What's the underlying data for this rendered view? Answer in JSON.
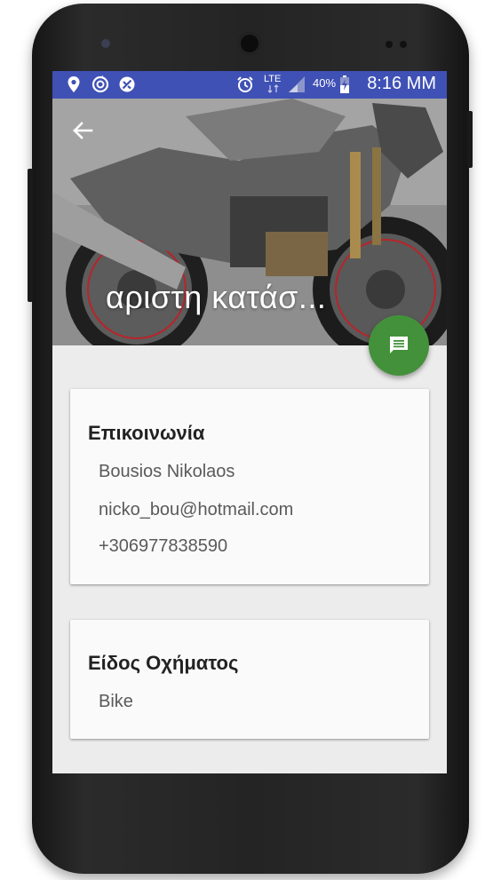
{
  "status_bar": {
    "network": "LTE",
    "battery": "40%",
    "time": "8:16 MM",
    "color": "#3f51b5"
  },
  "header": {
    "title": "αριστη κατάσ..."
  },
  "contact_card": {
    "title": "Επικοινωνία",
    "name": "Bousios Nikolaos",
    "email": "nicko_bou@hotmail.com",
    "phone": "+306977838590"
  },
  "vehicle_card": {
    "title": "Είδος Οχήματος",
    "value": "Bike"
  },
  "accent": {
    "fab": "#43913a"
  }
}
